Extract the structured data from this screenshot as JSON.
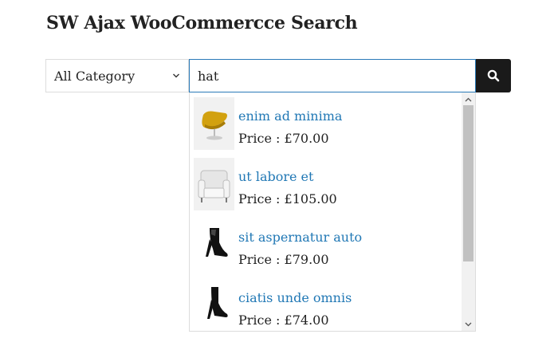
{
  "page_title": "SW Ajax WooCommercce Search",
  "search": {
    "category_selected": "All Category",
    "query": "hat",
    "button_icon": "search-icon"
  },
  "results": [
    {
      "name": "enim ad minima",
      "price": "Price : £70.00",
      "thumb_icon": "yellow-lounge-chair",
      "color": "#d2a10f"
    },
    {
      "name": "ut labore et",
      "price": "Price : £105.00",
      "thumb_icon": "white-armchair",
      "color": "#ececec"
    },
    {
      "name": "sit aspernatur auto",
      "price": "Price : £79.00",
      "thumb_icon": "black-heeled-bootie",
      "color": "#111111"
    },
    {
      "name": "ciatis unde omnis",
      "price": "Price : £74.00",
      "thumb_icon": "black-heeled-bootie",
      "color": "#111111"
    }
  ],
  "colors": {
    "link": "#2178b5",
    "input_border": "#2a7ab8",
    "button_bg": "#1a1a1a"
  }
}
